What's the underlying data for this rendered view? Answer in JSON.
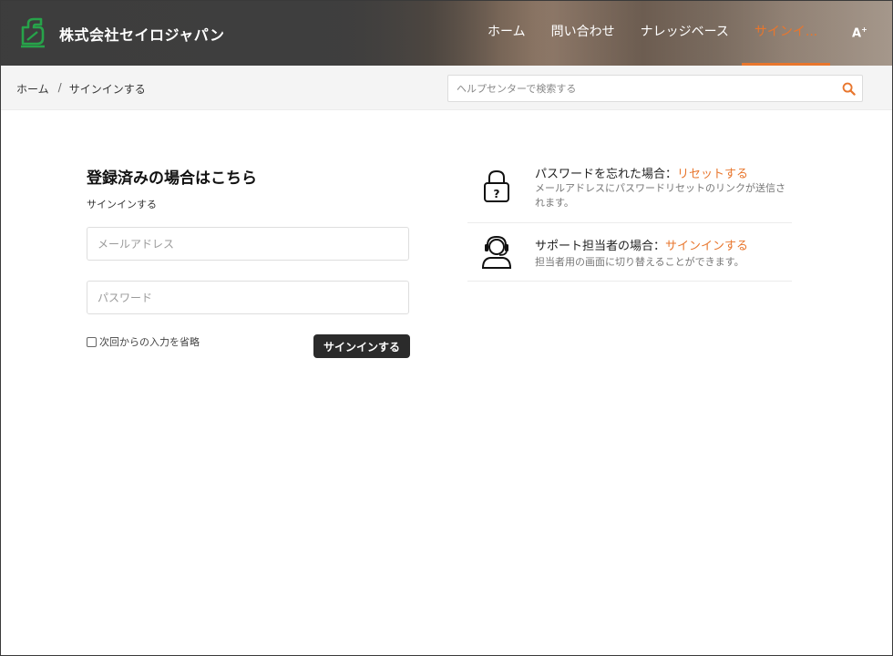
{
  "header": {
    "brand": "株式会社セイロジャパン",
    "nav": [
      {
        "label": "ホーム",
        "active": false
      },
      {
        "label": "問い合わせ",
        "active": false
      },
      {
        "label": "ナレッジベース",
        "active": false
      },
      {
        "label": "サインイ...",
        "active": true
      }
    ],
    "font_toggle": "A",
    "accent_color": "#e8762d",
    "logo_color": "#27a34a"
  },
  "breadcrumb": {
    "home": "ホーム",
    "separator": "/",
    "current": "サインインする"
  },
  "search": {
    "placeholder": "ヘルプセンターで検索する",
    "value": ""
  },
  "signin": {
    "title": "登録済みの場合はこちら",
    "subtitle": "サインインする",
    "email_placeholder": "メールアドレス",
    "password_placeholder": "パスワード",
    "remember_label": "次回からの入力を省略",
    "remember_checked": false,
    "submit_label": "サインインする"
  },
  "info": {
    "forgot": {
      "title": "パスワードを忘れた場合：",
      "link": "リセットする",
      "desc": "メールアドレスにパスワードリセットのリンクが送信されます。"
    },
    "agent": {
      "title": "サポート担当者の場合：",
      "link": "サインインする",
      "desc": "担当者用の画面に切り替えることができます。"
    }
  }
}
